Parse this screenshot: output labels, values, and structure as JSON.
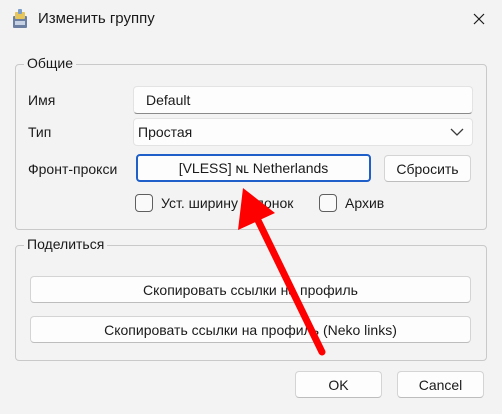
{
  "window": {
    "title": "Изменить группу",
    "icon": "app-icon",
    "close_icon": "close-icon"
  },
  "general": {
    "legend": "Общие",
    "name_label": "Имя",
    "name_value": "Default",
    "type_label": "Тип",
    "type_value": "Простая",
    "front_proxy_label": "Фронт-прокси",
    "front_proxy_value": "[VLESS] ɴʟ Netherlands",
    "reset_label": "Сбросить",
    "column_width_label": "Уст. ширину колонок",
    "archive_label": "Архив"
  },
  "share": {
    "legend": "Поделиться",
    "copy_links_label": "Скопировать ссылки на профиль",
    "copy_neko_links_label": "Скопировать ссылки на профиль (Neko links)"
  },
  "footer": {
    "ok_label": "OK",
    "cancel_label": "Cancel"
  },
  "annotation": {
    "arrow_color": "#ff0000"
  }
}
